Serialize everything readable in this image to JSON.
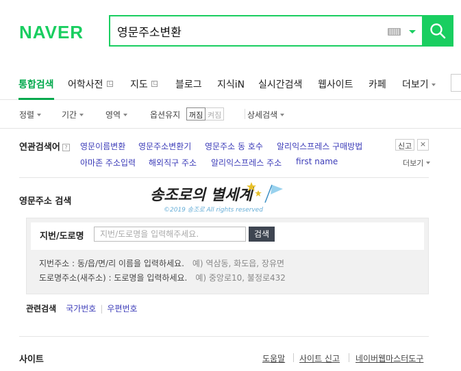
{
  "header": {
    "logo_text": "NAVER",
    "search_query": "영문주소변환",
    "colors": {
      "brand": "#19ce60",
      "link": "#3b3bb8"
    }
  },
  "tabs": [
    {
      "label": "통합검색",
      "active": true
    },
    {
      "label": "어학사전",
      "popup": true
    },
    {
      "label": "지도",
      "popup": true
    },
    {
      "label": "블로그"
    },
    {
      "label": "지식iN"
    },
    {
      "label": "실시간검색"
    },
    {
      "label": "웹사이트"
    },
    {
      "label": "카페"
    },
    {
      "label": "더보기"
    }
  ],
  "options": {
    "sort": "정렬",
    "period": "기간",
    "area": "영역",
    "keep_label": "옵션유지",
    "keep_on": "꺼짐",
    "keep_off": "켜짐",
    "detail": "상세검색"
  },
  "related": {
    "title": "연관검색어",
    "help_icon": "?",
    "items": [
      "영문이름변환",
      "영문주소변환기",
      "영문주소 동 호수",
      "알리익스프레스 구매방법",
      "아마존 주소입력",
      "해외직구 주소",
      "알리익스프레스 주소",
      "first name"
    ],
    "report": "신고",
    "close": "×",
    "more": "더보기"
  },
  "address_widget": {
    "section_title": "영문주소 검색",
    "field_label": "지번/도로명",
    "placeholder": "지번/도로명을 입력해주세요.",
    "button": "검색",
    "hint1_text": "지번주소 : 동/읍/면/리 이름을 입력하세요.",
    "hint1_example": "예) 역삼동, 화도읍, 장유면",
    "hint2_text": "도로명주소(새주소) : 도로명을 입력하세요.",
    "hint2_example": "예) 중앙로10, 불정로432",
    "related_title": "관련검색",
    "related_links": [
      "국가번호",
      "우편번호"
    ]
  },
  "watermark": {
    "line1": "송조로의 별세계",
    "line2": "©2019 송조로 All rights reserved"
  },
  "footer": {
    "title": "사이트",
    "links": [
      "도움말",
      "사이트 신고",
      "네이버웹마스터도구"
    ]
  }
}
